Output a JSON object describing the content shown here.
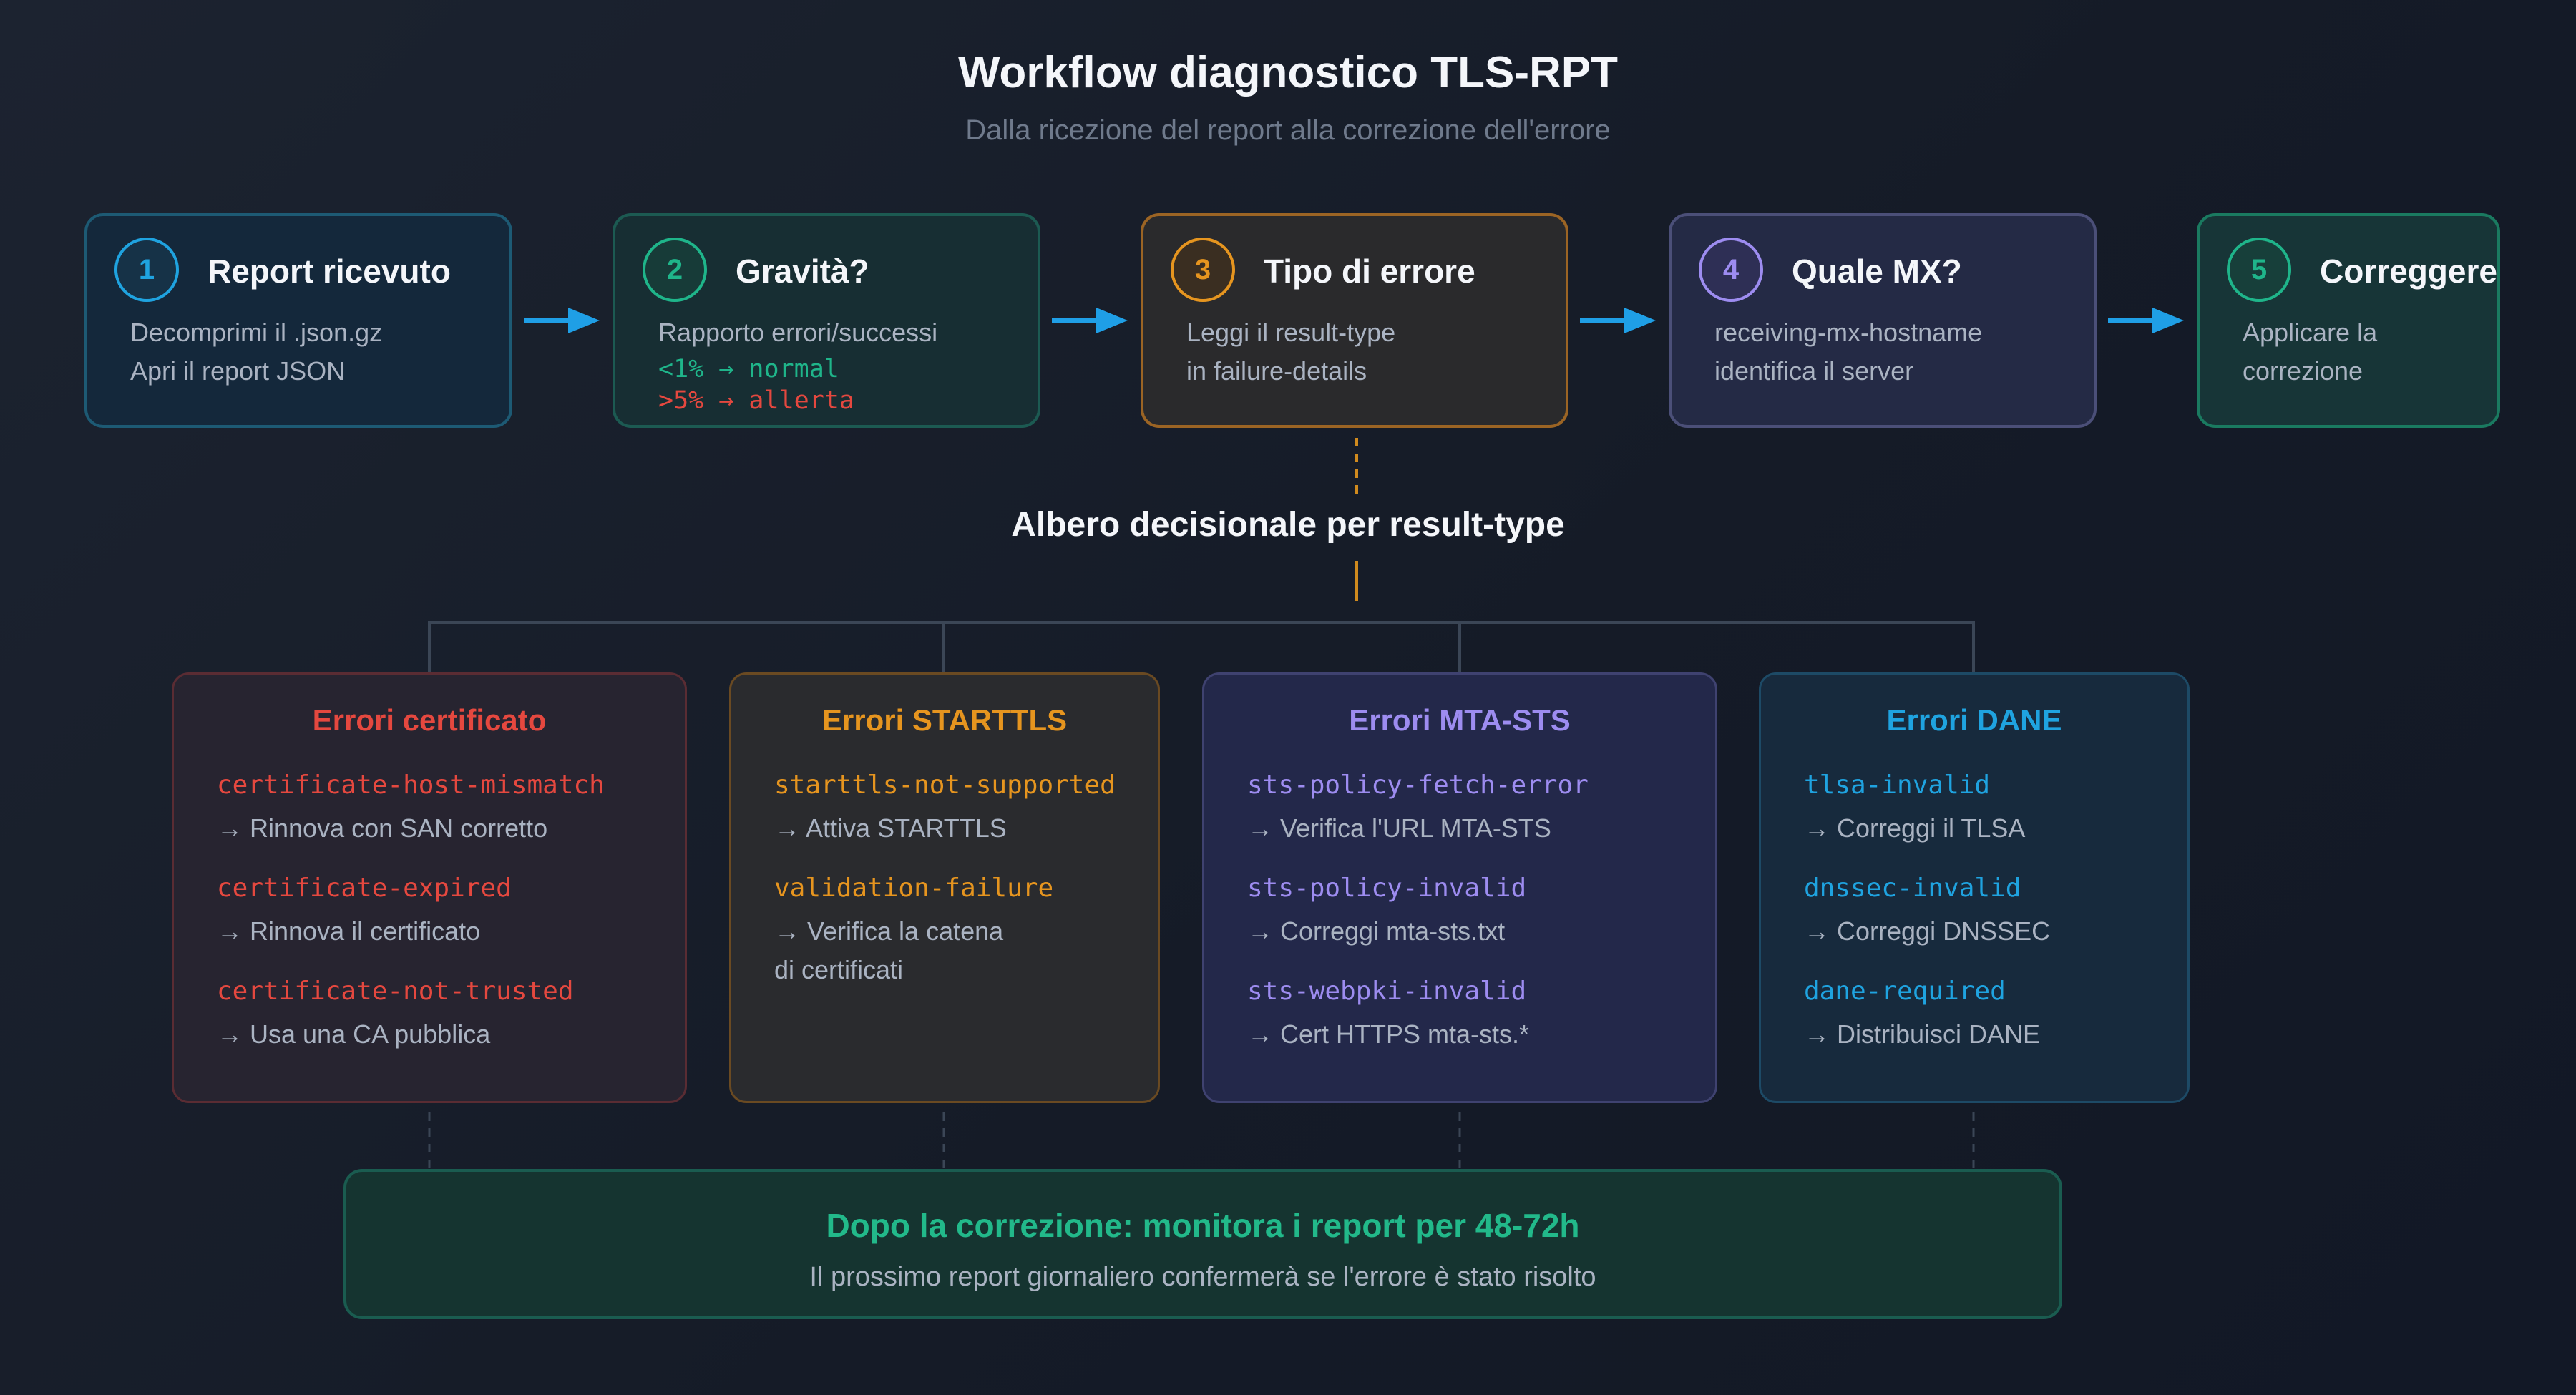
{
  "header": {
    "title": "Workflow diagnostico TLS-RPT",
    "subtitle": "Dalla ricezione del report alla correzione dell'errore"
  },
  "steps": [
    {
      "number": "1",
      "title": "Report ricevuto",
      "lines": [
        "Decomprimi il .json.gz",
        "Apri il report JSON"
      ]
    },
    {
      "number": "2",
      "title": "Gravità?",
      "lines": [
        "Rapporto errori/successi",
        "<1% → normal",
        ">5% → allerta"
      ]
    },
    {
      "number": "3",
      "title": "Tipo di errore",
      "lines": [
        "Leggi il result-type",
        "in failure-details"
      ]
    },
    {
      "number": "4",
      "title": "Quale MX?",
      "lines": [
        "receiving-mx-hostname",
        "identifica il server"
      ]
    },
    {
      "number": "5",
      "title": "Correggere",
      "lines": [
        "Applicare la",
        "correzione"
      ]
    }
  ],
  "tree": {
    "label": "Albero decisionale per result-type"
  },
  "categories": [
    {
      "title": "Errori certificato",
      "items": [
        {
          "code": "certificate-host-mismatch",
          "action": "→ Rinnova con SAN corretto"
        },
        {
          "code": "certificate-expired",
          "action": "→ Rinnova il certificato"
        },
        {
          "code": "certificate-not-trusted",
          "action": "→ Usa una CA pubblica"
        }
      ]
    },
    {
      "title": "Errori STARTTLS",
      "items": [
        {
          "code": "starttls-not-supported",
          "action": "→ Attiva STARTTLS"
        },
        {
          "code": "validation-failure",
          "action": "→ Verifica la catena",
          "action2": "di certificati"
        }
      ]
    },
    {
      "title": "Errori MTA-STS",
      "items": [
        {
          "code": "sts-policy-fetch-error",
          "action": "→ Verifica l'URL MTA-STS"
        },
        {
          "code": "sts-policy-invalid",
          "action": "→ Correggi mta-sts.txt"
        },
        {
          "code": "sts-webpki-invalid",
          "action": "→ Cert HTTPS mta-sts.*"
        }
      ]
    },
    {
      "title": "Errori DANE",
      "items": [
        {
          "code": "tlsa-invalid",
          "action": "→ Correggi il TLSA"
        },
        {
          "code": "dnssec-invalid",
          "action": "→ Correggi DNSSEC"
        },
        {
          "code": "dane-required",
          "action": "→ Distribuisci DANE"
        }
      ]
    }
  ],
  "footer": {
    "title": "Dopo la correzione: monitora i report per 48-72h",
    "text": "Il prossimo report giornaliero confermerà se l'errore è stato risolto"
  },
  "colors": {
    "blue": "#1fa3e0",
    "green": "#1fb58a",
    "orange": "#e6951f",
    "purple": "#9d8cf0",
    "red": "#e5483f",
    "arrow": "#1f9fe6"
  },
  "icons": {
    "arrow": "arrow-right-icon"
  }
}
